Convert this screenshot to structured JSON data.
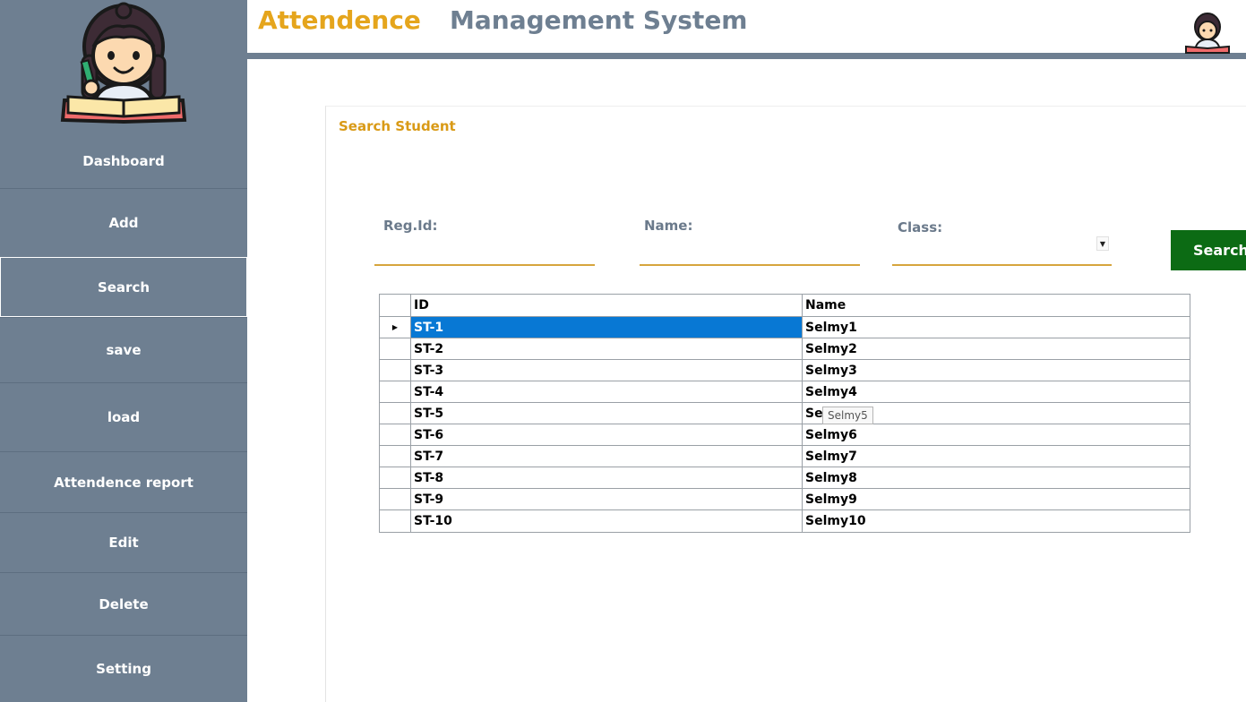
{
  "header": {
    "title_part1": "Attendence",
    "title_part2": "Management System"
  },
  "sidebar": {
    "items": [
      {
        "label": "Dashboard"
      },
      {
        "label": "Add"
      },
      {
        "label": "Search"
      },
      {
        "label": "save"
      },
      {
        "label": "load"
      },
      {
        "label": "Attendence report"
      },
      {
        "label": "Edit"
      },
      {
        "label": "Delete"
      },
      {
        "label": "Setting"
      }
    ],
    "active": "Search"
  },
  "search_panel": {
    "title": "Search Student",
    "reg_id_label": "Reg.Id:",
    "reg_id_value": "",
    "name_label": "Name:",
    "name_value": "",
    "class_label": "Class:",
    "class_value": "",
    "search_button": "Search"
  },
  "grid": {
    "columns": [
      "ID",
      "Name"
    ],
    "rows": [
      {
        "id": "ST-1",
        "name": "Selmy1"
      },
      {
        "id": "ST-2",
        "name": "Selmy2"
      },
      {
        "id": "ST-3",
        "name": "Selmy3"
      },
      {
        "id": "ST-4",
        "name": "Selmy4"
      },
      {
        "id": "ST-5",
        "name": "Se"
      },
      {
        "id": "ST-6",
        "name": "Selmy6"
      },
      {
        "id": "ST-7",
        "name": "Selmy7"
      },
      {
        "id": "ST-8",
        "name": "Selmy8"
      },
      {
        "id": "ST-9",
        "name": "Selmy9"
      },
      {
        "id": "ST-10",
        "name": "Selmy10"
      }
    ],
    "selected_row": "ST-1",
    "tooltip": "Selmy5"
  },
  "colors": {
    "sidebar": "#6e7f91",
    "accent_gold": "#e5a51c",
    "search_button": "#0c6b14",
    "selection": "#0878d4"
  },
  "icons": {
    "logo": "student-reading-logo",
    "avatar": "student-avatar-icon",
    "row_selector": "row-pointer-icon",
    "dropdown": "chevron-down-icon"
  }
}
